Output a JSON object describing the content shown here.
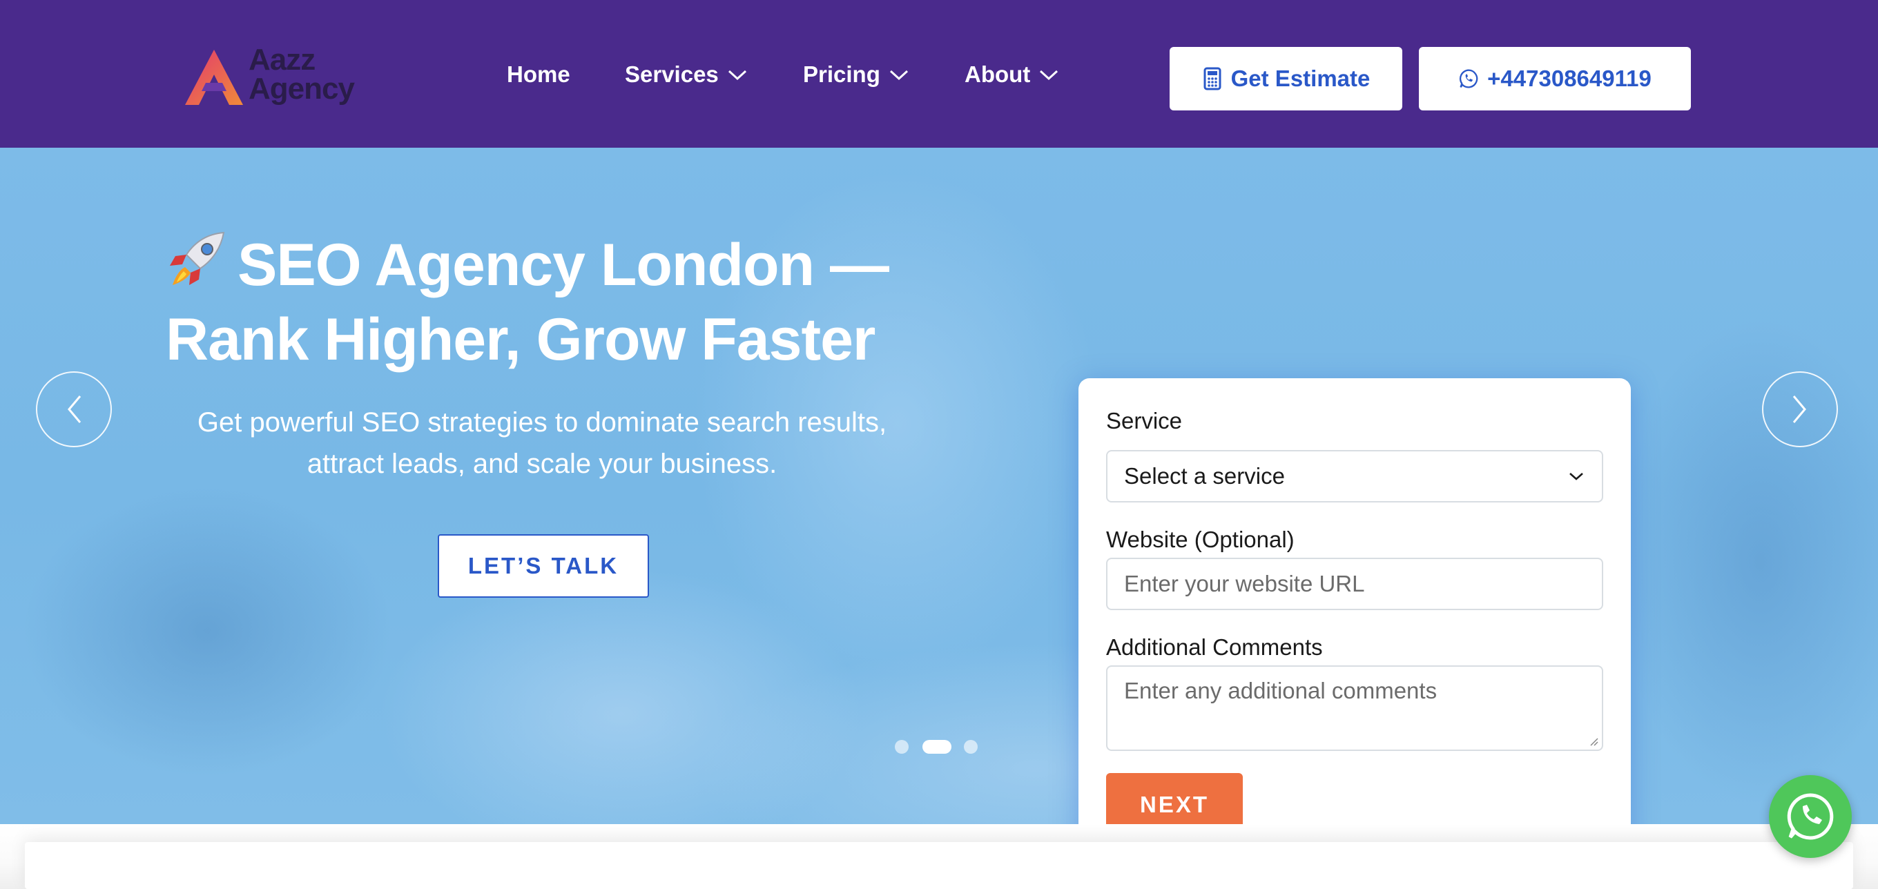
{
  "brand": {
    "line1": "Aazz",
    "line2": "Agency",
    "colors": {
      "header_bg": "#4a2a8c",
      "accent_blue": "#2a58c8",
      "cta_orange": "#ee7040",
      "whatsapp_green": "#4fc75a"
    }
  },
  "nav": {
    "items": [
      {
        "label": "Home",
        "has_dropdown": false
      },
      {
        "label": "Services",
        "has_dropdown": true
      },
      {
        "label": "Pricing",
        "has_dropdown": true
      },
      {
        "label": "About",
        "has_dropdown": true
      }
    ],
    "estimate_label": "Get Estimate",
    "phone_label": "+447308649119",
    "estimate_icon": "calculator-icon",
    "phone_icon": "whatsapp-icon"
  },
  "hero": {
    "title_line1": "SEO Agency London —",
    "title_line2": "Rank Higher, Grow Faster",
    "title_icon": "rocket-icon",
    "subtitle_line1": "Get powerful SEO strategies to dominate search results,",
    "subtitle_line2": "attract leads, and scale your business.",
    "cta_label": "LET’S TALK",
    "slides_total": 3,
    "active_slide": 2
  },
  "form": {
    "service_label": "Service",
    "service_value": "Select a service",
    "website_label": "Website (Optional)",
    "website_placeholder": "Enter your website URL",
    "comments_label": "Additional Comments",
    "comments_placeholder": "Enter any additional comments",
    "next_label": "NEXT"
  }
}
